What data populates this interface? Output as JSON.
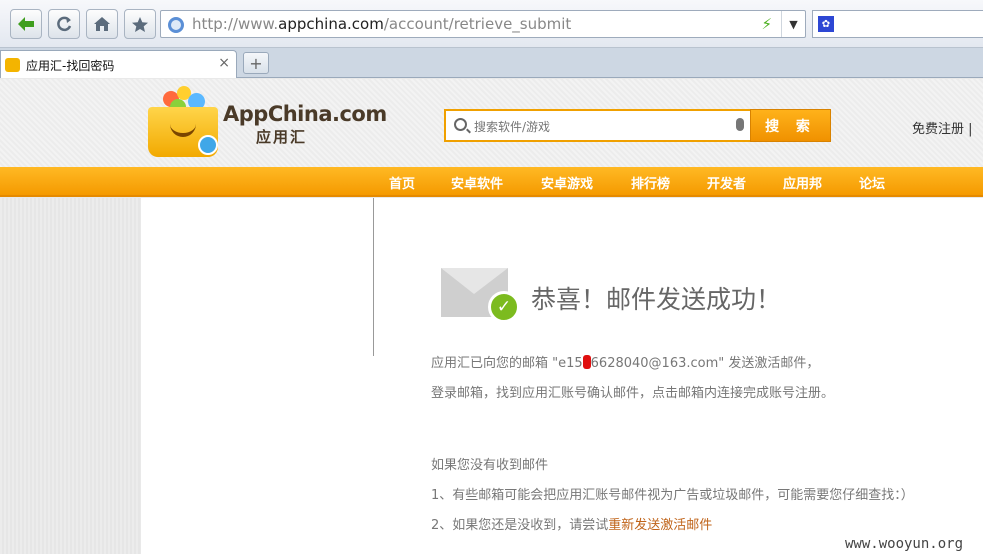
{
  "browser": {
    "url_prefix": "http://www.",
    "url_domain": "appchina.com",
    "url_path": "/account/retrieve_submit",
    "tab_title": "应用汇-找回密码",
    "tab_close": "×",
    "new_tab": "+"
  },
  "site": {
    "logo_name": "AppChina.com",
    "logo_cn": "应用汇",
    "search_placeholder": "搜索软件/游戏",
    "search_button": "搜 索",
    "register_link": "免费注册 | ",
    "nav": [
      "首页",
      "安卓软件",
      "安卓游戏",
      "排行榜",
      "开发者",
      "应用邦",
      "论坛"
    ]
  },
  "content": {
    "success_title": "恭喜！邮件发送成功！",
    "line1_pre": "应用汇已向您的邮箱 \"e15",
    "line1_post": "6628040@163.com\" 发送激活邮件，",
    "line2": "登录邮箱，找到应用汇账号确认邮件，点击邮箱内连接完成账号注册。",
    "help_title": "如果您没有收到邮件",
    "help1": "1、有些邮箱可能会把应用汇账号邮件视为广告或垃圾邮件，可能需要您仔细查找：）",
    "help2_pre": "2、如果您还是没收到，请尝试",
    "help2_link": "重新发送激活邮件"
  },
  "watermark": "www.wooyun.org",
  "colors": {
    "accent_orange": "#f59a00",
    "link_orange": "#c0641a",
    "check_green": "#7cbb1f"
  }
}
